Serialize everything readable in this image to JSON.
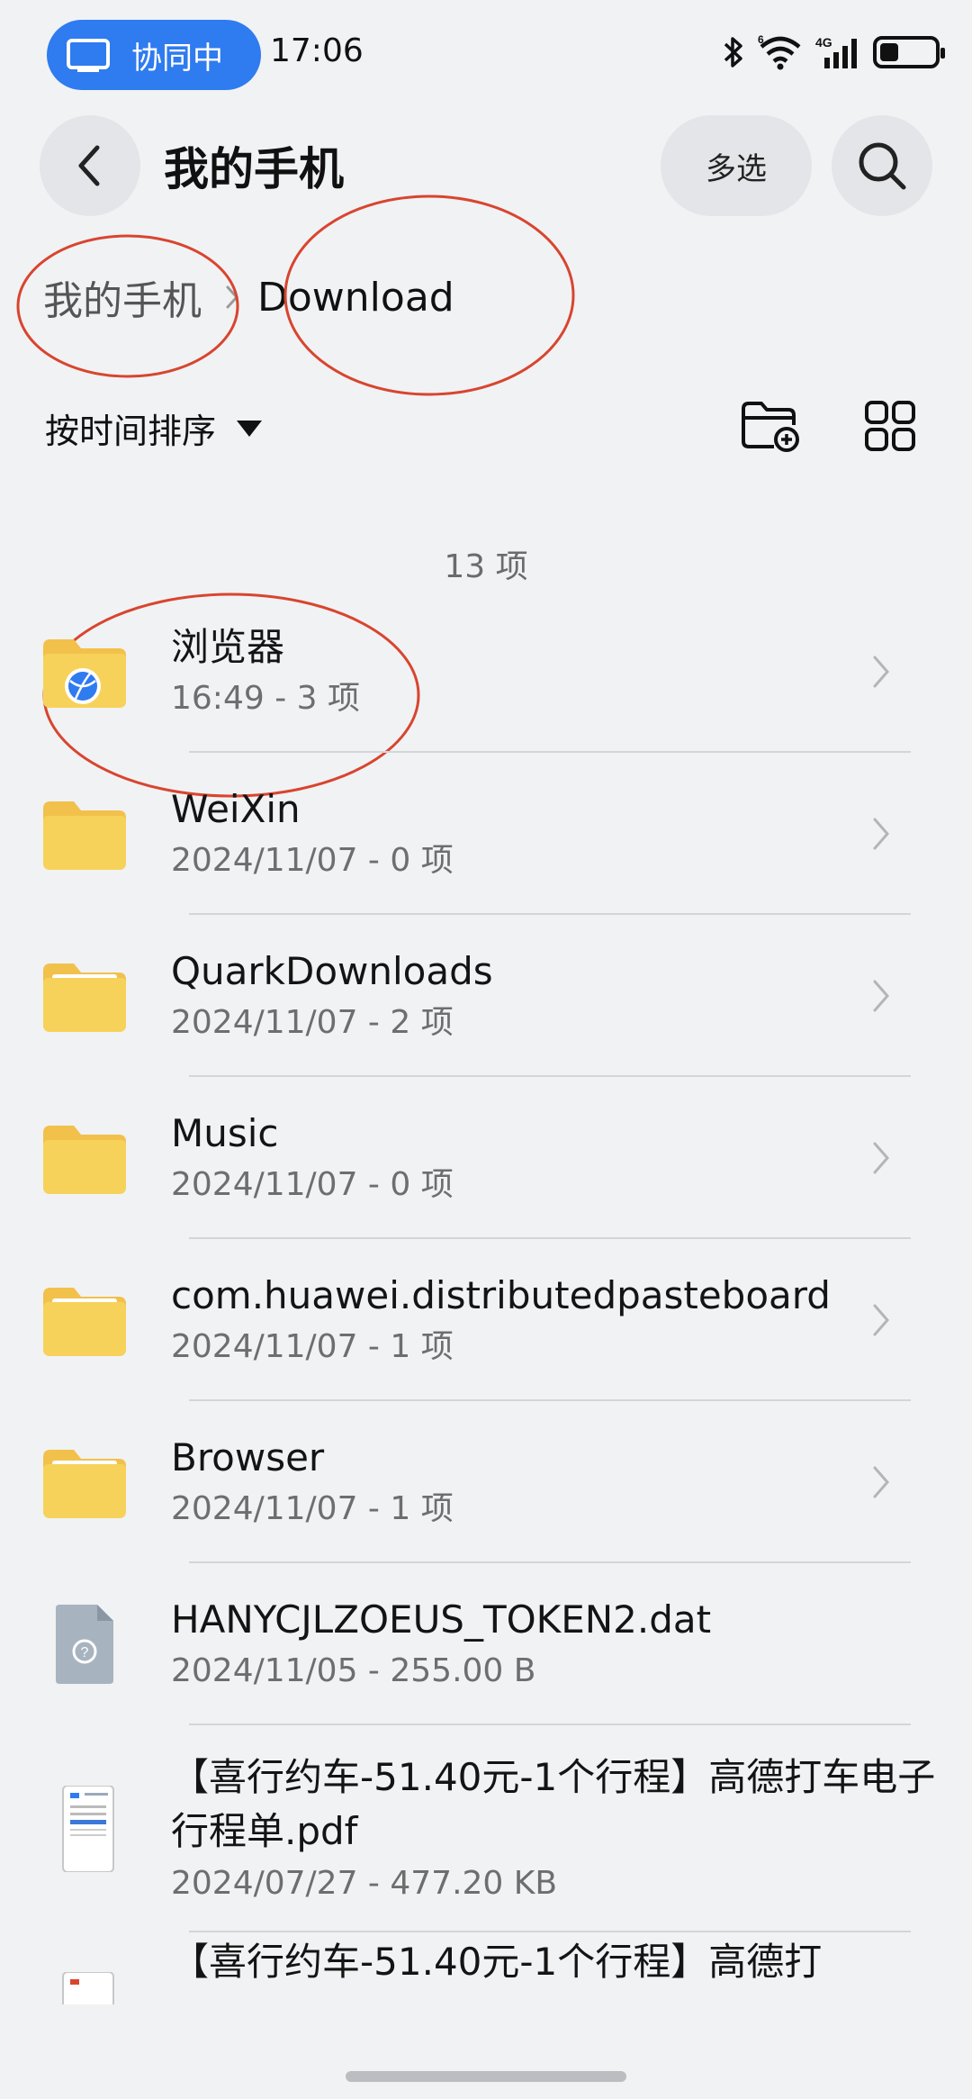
{
  "status_bar": {
    "collab_label": "协同中",
    "time": "17:06",
    "network_badge": "4G",
    "wifi_badge": "6",
    "battery_level": 0.35
  },
  "header": {
    "title": "我的手机",
    "multiselect_label": "多选"
  },
  "breadcrumb": {
    "root": "我的手机",
    "current": "Download"
  },
  "toolbar": {
    "sort_label": "按时间排序"
  },
  "item_count": "13 项",
  "items": [
    {
      "name": "浏览器",
      "meta": "16:49 - 3 项",
      "icon": "browser-folder-icon"
    },
    {
      "name": "WeiXin",
      "meta": "2024/11/07 - 0 项",
      "icon": "folder-icon"
    },
    {
      "name": "QuarkDownloads",
      "meta": "2024/11/07 - 2 项",
      "icon": "folder-icon"
    },
    {
      "name": "Music",
      "meta": "2024/11/07 - 0 项",
      "icon": "folder-icon"
    },
    {
      "name": "com.huawei.distributedpasteboard",
      "meta": "2024/11/07 - 1 项",
      "icon": "folder-icon"
    },
    {
      "name": "Browser",
      "meta": "2024/11/07 - 1 项",
      "icon": "folder-icon"
    },
    {
      "name": "HANYCJLZOEUS_TOKEN2.dat",
      "meta": "2024/11/05 - 255.00 B",
      "icon": "unknown-file-icon"
    },
    {
      "name": "【喜行约车-51.40元-1个行程】高德打车电子行程单.pdf",
      "meta": "2024/07/27 - 477.20 KB",
      "icon": "pdf-thumbnail-icon"
    },
    {
      "name": "【喜行约车-51.40元-1个行程】高德打",
      "meta": "",
      "icon": "pdf-thumbnail-icon"
    }
  ],
  "colors": {
    "accent": "#2f7bf0",
    "annotation": "#d8452f",
    "folder": "#f7d25b"
  }
}
